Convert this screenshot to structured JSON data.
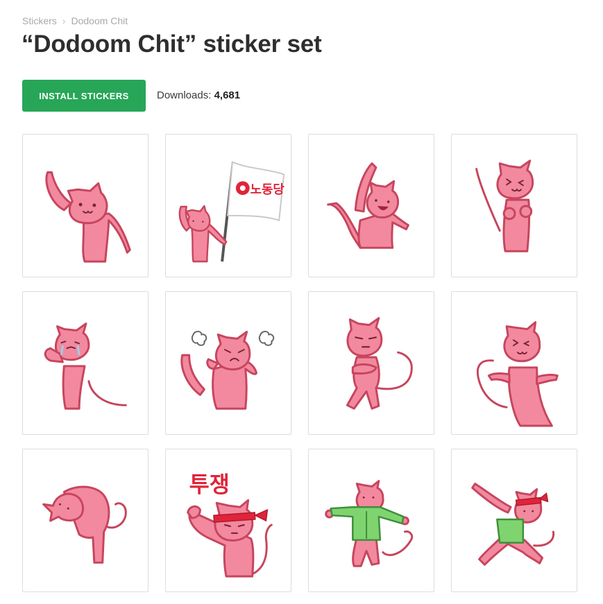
{
  "breadcrumb": {
    "items": [
      "Stickers",
      "Dodoom Chit"
    ],
    "separator": "›"
  },
  "page": {
    "title": "“Dodoom Chit” sticker set"
  },
  "actions": {
    "install_label": "INSTALL STICKERS",
    "downloads_label": "Downloads:",
    "downloads_count": "4,681"
  },
  "stickers": [
    {
      "id": 1,
      "icon": "cat-waving-icon"
    },
    {
      "id": 2,
      "icon": "cat-holding-flag-icon",
      "text": "노동당"
    },
    {
      "id": 3,
      "icon": "cat-cheering-icon"
    },
    {
      "id": 4,
      "icon": "cat-happy-fists-icon"
    },
    {
      "id": 5,
      "icon": "cat-crying-icon"
    },
    {
      "id": 6,
      "icon": "cat-angry-steam-icon"
    },
    {
      "id": 7,
      "icon": "cat-arms-crossed-icon"
    },
    {
      "id": 8,
      "icon": "cat-pointing-wink-icon"
    },
    {
      "id": 9,
      "icon": "cat-bowing-icon"
    },
    {
      "id": 10,
      "icon": "cat-fight-headband-icon",
      "text": "투쟁"
    },
    {
      "id": 11,
      "icon": "cat-green-shirt-icon"
    },
    {
      "id": 12,
      "icon": "cat-dab-icon"
    }
  ],
  "colors": {
    "accent": "#27a658",
    "cat_fill": "#f2899f",
    "cat_outline": "#c7455d",
    "headband": "#e0243a",
    "shirt": "#7fd470"
  }
}
